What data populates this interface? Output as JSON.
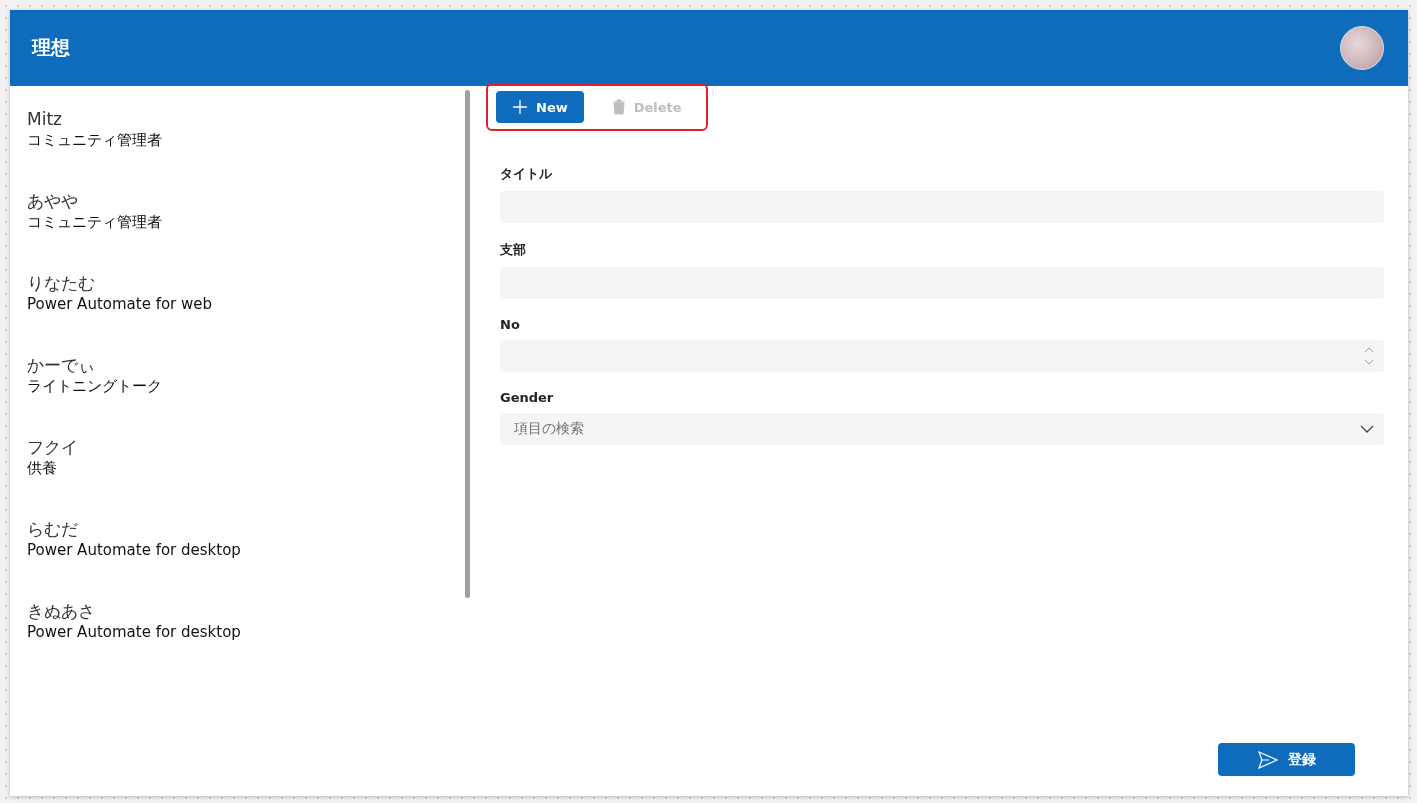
{
  "header": {
    "title": "理想"
  },
  "list": [
    {
      "name": "Mitz",
      "subtitle": "コミュニティ管理者"
    },
    {
      "name": "あやや",
      "subtitle": "コミュニティ管理者"
    },
    {
      "name": "りなたむ",
      "subtitle": "Power Automate for web"
    },
    {
      "name": "かーでぃ",
      "subtitle": "ライトニングトーク"
    },
    {
      "name": "フクイ",
      "subtitle": "供養"
    },
    {
      "name": "らむだ",
      "subtitle": "Power Automate for desktop"
    },
    {
      "name": "きぬあさ",
      "subtitle": "Power Automate for desktop"
    }
  ],
  "toolbar": [
    {
      "kind": "new",
      "label": "New",
      "disabled": false
    },
    {
      "kind": "delete",
      "label": "Delete",
      "disabled": true
    }
  ],
  "form": [
    {
      "kind": "text",
      "label": "タイトル"
    },
    {
      "kind": "text",
      "label": "支部"
    },
    {
      "kind": "number",
      "label": "No"
    },
    {
      "kind": "dropdown",
      "label": "Gender",
      "placeholder": "項目の検索"
    }
  ],
  "submit": {
    "label": "登録"
  }
}
